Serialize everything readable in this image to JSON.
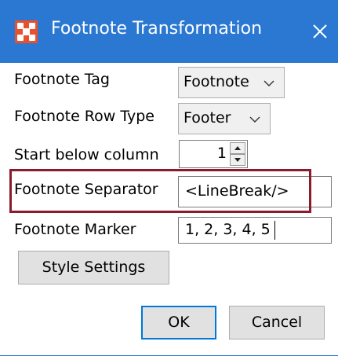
{
  "window": {
    "title": "Footnote Transformation",
    "app_icon": "grid-app-icon",
    "close_icon": "close-icon"
  },
  "form": {
    "footnote_tag": {
      "label": "Footnote Tag",
      "value": "Footnote"
    },
    "footnote_row_type": {
      "label": "Footnote Row Type",
      "value": "Footer"
    },
    "start_below_column": {
      "label": "Start below column",
      "value": "1"
    },
    "footnote_separator": {
      "label": "Footnote Separator",
      "value": "<LineBreak/>"
    },
    "footnote_marker": {
      "label": "Footnote Marker",
      "value": "1, 2, 3, 4, 5"
    }
  },
  "buttons": {
    "style_settings": "Style Settings",
    "ok": "OK",
    "cancel": "Cancel"
  },
  "colors": {
    "titlebar": "#2b78d3",
    "highlight_box": "#8b1a2a",
    "app_icon": "#e8502e"
  }
}
